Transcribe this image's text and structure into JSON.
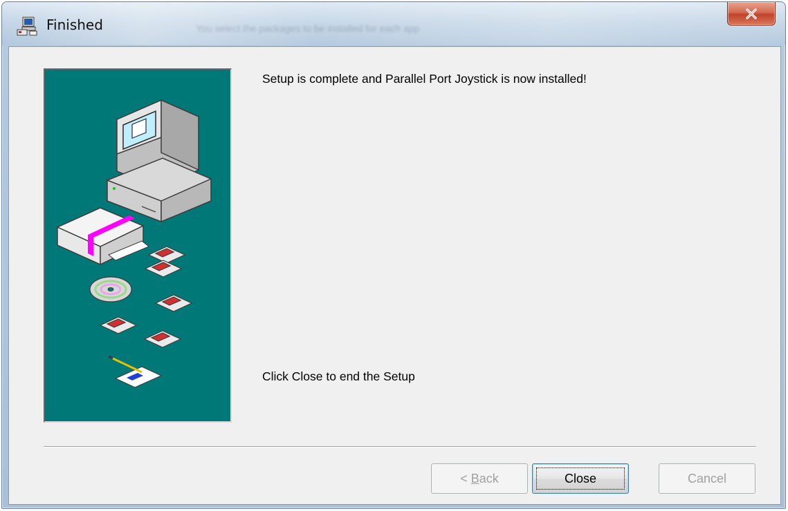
{
  "window": {
    "title": "Finished",
    "background_title_ghost": "You select the packages to be installed for each app"
  },
  "content": {
    "message_top": "Setup is complete and Parallel Port Joystick is now installed!",
    "message_bottom": "Click Close to end the Setup"
  },
  "buttons": {
    "back_prefix": "< ",
    "back_mnemonic": "B",
    "back_rest": "ack",
    "close": "Close",
    "cancel": "Cancel"
  },
  "icons": {
    "title": "setup-computer-icon",
    "close": "close-icon",
    "illustration": "setup-wizard-illustration"
  },
  "colors": {
    "side_panel": "#007878",
    "dialog_bg": "#f0f0f0",
    "close_button": "#c1432b"
  }
}
